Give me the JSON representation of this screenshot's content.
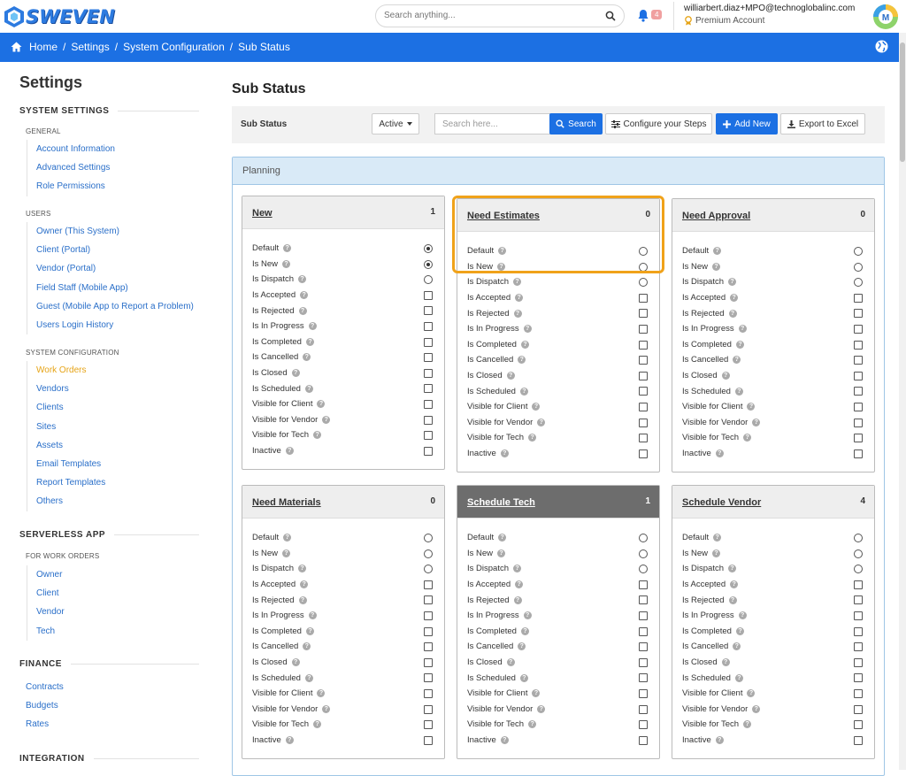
{
  "app": {
    "logo_text": "SWEVEN"
  },
  "header": {
    "search_placeholder": "Search anything...",
    "notification_count": "4",
    "user_email": "williarbert.diaz+MPO@technoglobalinc.com",
    "plan": "Premium Account"
  },
  "breadcrumb": [
    "Home",
    "Settings",
    "System Configuration",
    "Sub Status"
  ],
  "sidebar": {
    "title": "Settings",
    "system_settings": "SYSTEM SETTINGS",
    "general": "GENERAL",
    "general_items": [
      "Account Information",
      "Advanced Settings",
      "Role Permissions"
    ],
    "users": "USERS",
    "users_items": [
      "Owner (This System)",
      "Client (Portal)",
      "Vendor (Portal)",
      "Field Staff (Mobile App)",
      "Guest (Mobile App to Report a Problem)",
      "Users Login History"
    ],
    "system_configuration": "SYSTEM CONFIGURATION",
    "config_items": [
      "Work Orders",
      "Vendors",
      "Clients",
      "Sites",
      "Assets",
      "Email Templates",
      "Report Templates",
      "Others"
    ],
    "serverless_app": "SERVERLESS APP",
    "for_work_orders": "FOR WORK ORDERS",
    "serverless_items": [
      "Owner",
      "Client",
      "Vendor",
      "Tech"
    ],
    "finance": "FINANCE",
    "finance_items": [
      "Contracts",
      "Budgets",
      "Rates"
    ],
    "integration": "INTEGRATION"
  },
  "main": {
    "page_title": "Sub Status",
    "toolbar": {
      "label": "Sub Status",
      "status_select": "Active",
      "search_placeholder": "Search here...",
      "search_button": "Search",
      "configure_button": "Configure your Steps",
      "add_button": "Add New",
      "export_button": "Export to Excel"
    },
    "panel_title": "Planning",
    "field_labels": [
      "Default",
      "Is New",
      "Is Dispatch",
      "Is Accepted",
      "Is Rejected",
      "Is In Progress",
      "Is Completed",
      "Is Cancelled",
      "Is Closed",
      "Is Scheduled",
      "Visible for Client",
      "Visible for Vendor",
      "Visible for Tech",
      "Inactive"
    ],
    "cards": [
      {
        "name": "New",
        "count": "1",
        "default_on": true,
        "new_on": true,
        "dark": false
      },
      {
        "name": "Need Estimates",
        "count": "0",
        "default_on": false,
        "new_on": false,
        "dark": false
      },
      {
        "name": "Need Approval",
        "count": "0",
        "default_on": false,
        "new_on": false,
        "dark": false
      },
      {
        "name": "Need Materials",
        "count": "0",
        "default_on": false,
        "new_on": false,
        "dark": false
      },
      {
        "name": "Schedule Tech",
        "count": "1",
        "default_on": false,
        "new_on": false,
        "dark": true
      },
      {
        "name": "Schedule Vendor",
        "count": "4",
        "default_on": false,
        "new_on": false,
        "dark": false
      }
    ]
  },
  "colors": {
    "primary": "#1c70e3",
    "link": "#2a6fc9",
    "active_link": "#e6a417",
    "highlight": "#f0a21a"
  }
}
